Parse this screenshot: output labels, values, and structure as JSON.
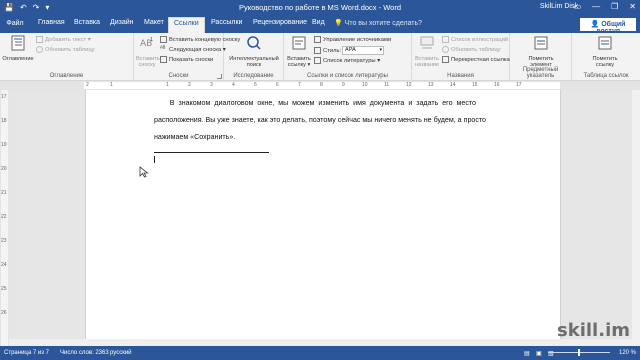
{
  "titlebar": {
    "title": "Руководство по работе в MS Word.docx  -  Word",
    "user": "SkilLim Disk",
    "qat": [
      "💾",
      "↶",
      "↷",
      "▾"
    ],
    "win": [
      "▭",
      "—",
      "❐",
      "✕"
    ]
  },
  "tabs": {
    "file": "Файл",
    "items": [
      "Главная",
      "Вставка",
      "Дизайн",
      "Макет",
      "Ссылки",
      "Рассылки",
      "Рецензирование",
      "Вид"
    ],
    "active_index": 4,
    "tellme": "Что вы хотите сделать?",
    "tellme_icon": "💡",
    "share": "Общий доступ",
    "share_icon": "👤"
  },
  "ribbon": {
    "toc": {
      "big": "Оглавление",
      "add_text": "Добавить текст ▾",
      "update": "Обновить таблицу",
      "label": "Оглавление"
    },
    "footnotes": {
      "insert_footnote": "Вставить\nсноску",
      "insert_endnote": "Вставить концевую сноску",
      "next_footnote": "Следующая сноска ▾",
      "show_notes": "Показать сноски",
      "label": "Сноски"
    },
    "research": {
      "smart_lookup": "Интеллектуальный\nпоиск",
      "label": "Исследование"
    },
    "citations": {
      "insert_citation": "Вставить\nссылку ▾",
      "manage_sources": "Управление источниками",
      "style_label": "Стиль:",
      "style_value": "APA",
      "bibliography": "Список литературы ▾",
      "label": "Ссылки и список литературы"
    },
    "captions": {
      "insert_caption": "Вставить\nназвание",
      "insert_table_figures": "Список иллюстраций",
      "update_table": "Обновить таблицу",
      "cross_ref": "Перекрестная ссылка",
      "label": "Названия"
    },
    "index": {
      "mark_entry": "Пометить\nэлемент",
      "label": "Предметный указатель"
    },
    "toa": {
      "mark_citation": "Пометить\nссылку",
      "label": "Таблица ссылок"
    }
  },
  "ruler": {
    "h_numbers": [
      "2",
      "1",
      "1",
      "2",
      "3",
      "4",
      "5",
      "6",
      "7",
      "8",
      "9",
      "10",
      "11",
      "12",
      "13",
      "14",
      "15",
      "16",
      "17"
    ],
    "v_numbers": [
      "17",
      "18",
      "19",
      "20",
      "21",
      "22",
      "23",
      "24",
      "25",
      "26"
    ]
  },
  "document": {
    "lines": [
      "        В  знакомом  диалоговом  окне,  мы  можем  изменить  имя  документа  и  задать  его  место",
      "расположения. Вы уже знаете, как это делать, поэтому сейчас мы ничего менять не будем, а просто",
      "нажимаем «Сохранить»."
    ]
  },
  "statusbar": {
    "page": "Страница 7 из 7",
    "words": "Число слов: 2363",
    "language": "русский",
    "zoom": "120 %",
    "view_icons": [
      "▤",
      "▣",
      "▥"
    ]
  },
  "watermark": "skill.im",
  "colors": {
    "accent": "#2b579a",
    "ribbon": "#f3f3f3"
  }
}
